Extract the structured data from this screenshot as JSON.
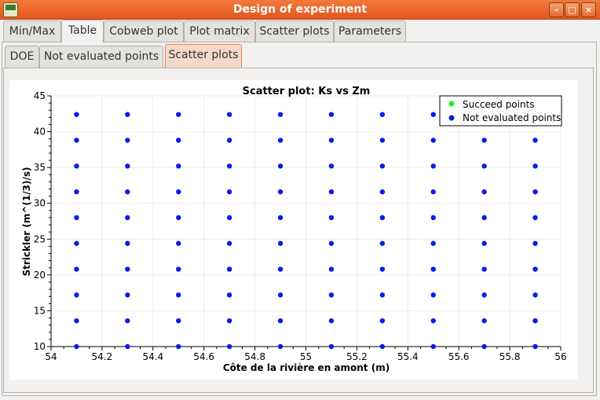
{
  "window": {
    "title": "Design of experiment"
  },
  "tabs": [
    {
      "label": "Min/Max"
    },
    {
      "label": "Table"
    },
    {
      "label": "Cobweb plot"
    },
    {
      "label": "Plot matrix"
    },
    {
      "label": "Scatter plots"
    },
    {
      "label": "Parameters"
    }
  ],
  "subtabs": [
    {
      "label": "DOE"
    },
    {
      "label": "Not evaluated points"
    },
    {
      "label": "Scatter plots"
    }
  ],
  "chart_data": {
    "type": "scatter",
    "title": "Scatter plot: Ks vs Zm",
    "xlabel": "Côte de la rivière en amont (m)",
    "ylabel": "Strickler (m^(1/3)/s)",
    "xlim": [
      54,
      56
    ],
    "ylim": [
      10,
      45
    ],
    "xticks": [
      "54",
      "54.2",
      "54.4",
      "54.6",
      "54.8",
      "55",
      "55.2",
      "55.4",
      "55.6",
      "55.8",
      "56"
    ],
    "yticks": [
      "10",
      "15",
      "20",
      "25",
      "30",
      "35",
      "40",
      "45"
    ],
    "grid": true,
    "legend_position": "top-right",
    "colors": {
      "succeed": "#22ee22",
      "not_evaluated": "#0a1bf0"
    },
    "series": [
      {
        "name": "Succeed points",
        "x": [],
        "y": []
      },
      {
        "name": "Not evaluated points",
        "x_levels": [
          54.1,
          54.3,
          54.5,
          54.7,
          54.9,
          55.1,
          55.3,
          55.5,
          55.7,
          55.9
        ],
        "y_levels": [
          10,
          13.6,
          17.2,
          20.8,
          24.4,
          28.0,
          31.6,
          35.2,
          38.8,
          42.4
        ]
      }
    ]
  }
}
